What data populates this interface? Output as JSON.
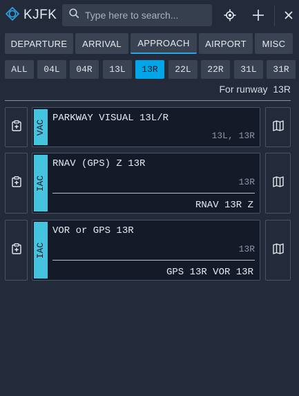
{
  "header": {
    "airport_code": "KJFK",
    "search": {
      "placeholder": "Type here to search...",
      "value": ""
    },
    "icons": [
      "crosshair-icon",
      "plus-icon",
      "close-icon"
    ]
  },
  "category_tabs": [
    {
      "label": "DEPARTURE",
      "active": false
    },
    {
      "label": "ARRIVAL",
      "active": false
    },
    {
      "label": "APPROACH",
      "active": true
    },
    {
      "label": "AIRPORT",
      "active": false
    },
    {
      "label": "MISC",
      "active": false
    }
  ],
  "runway_tabs": [
    {
      "label": "ALL",
      "active": false
    },
    {
      "label": "04L",
      "active": false
    },
    {
      "label": "04R",
      "active": false
    },
    {
      "label": "13L",
      "active": false
    },
    {
      "label": "13R",
      "active": true
    },
    {
      "label": "22L",
      "active": false
    },
    {
      "label": "22R",
      "active": false
    },
    {
      "label": "31L",
      "active": false
    },
    {
      "label": "31R",
      "active": false
    }
  ],
  "filter": {
    "prefix": "For runway",
    "runway": "13R"
  },
  "charts": [
    {
      "type": "VAC",
      "title": "PARKWAY VISUAL 13L/R",
      "runways": "13L, 13R",
      "ident": ""
    },
    {
      "type": "IAC",
      "title": "RNAV (GPS) Z 13R",
      "runways": "13R",
      "ident": "RNAV 13R Z"
    },
    {
      "type": "IAC",
      "title": "VOR or GPS 13R",
      "runways": "13R",
      "ident": "GPS 13R VOR 13R"
    }
  ],
  "colors": {
    "background": "#232b3a",
    "accent": "#00a6e8",
    "chart_tag": "#45c4e0",
    "card": "#141a27"
  }
}
